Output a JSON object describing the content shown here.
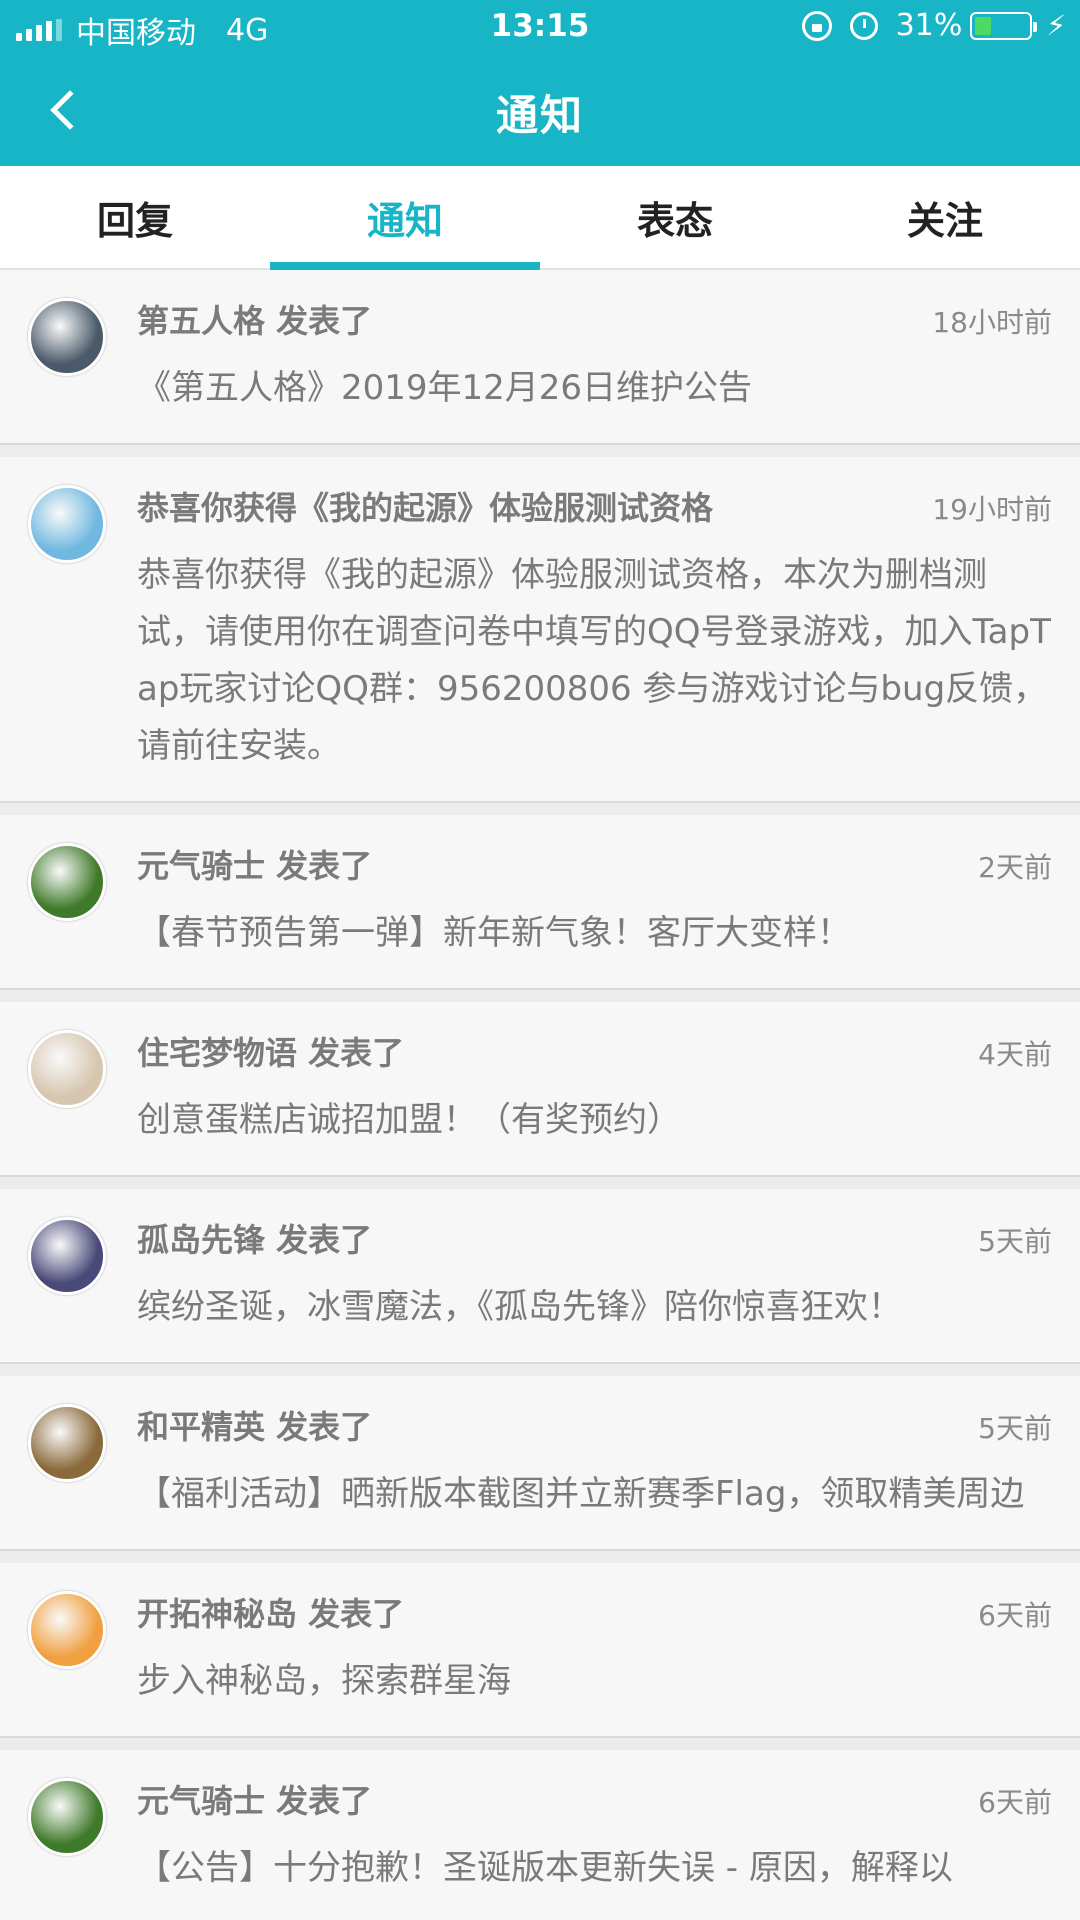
{
  "status_bar": {
    "carrier": "中国移动",
    "network": "4G",
    "time": "13:15",
    "battery_percent": "31%",
    "battery_level": 0.31
  },
  "header": {
    "title": "通知",
    "accent_color": "#17b5c5"
  },
  "tabs": [
    {
      "label": "回复",
      "active": false
    },
    {
      "label": "通知",
      "active": true
    },
    {
      "label": "表态",
      "active": false
    },
    {
      "label": "关注",
      "active": false
    }
  ],
  "notifications": [
    {
      "title": "第五人格 发表了",
      "time": "18小时前",
      "body": "《第五人格》2019年12月26日维护公告",
      "avatar_color": "#4a5a6a"
    },
    {
      "title": "恭喜你获得《我的起源》体验服测试资格",
      "time": "19小时前",
      "body": "恭喜你获得《我的起源》体验服测试资格，本次为删档测试，请使用你在调查问卷中填写的QQ号登录游戏，加入TapTap玩家讨论QQ群：956200806 参与游戏讨论与bug反馈，请前往安装。",
      "avatar_color": "#6fb8e0"
    },
    {
      "title": "元气骑士 发表了",
      "time": "2天前",
      "body": "【春节预告第一弹】新年新气象！客厅大变样！",
      "avatar_color": "#3f7a2a"
    },
    {
      "title": "住宅梦物语 发表了",
      "time": "4天前",
      "body": "创意蛋糕店诚招加盟！（有奖预约）",
      "avatar_color": "#d6c6b0"
    },
    {
      "title": "孤岛先锋 发表了",
      "time": "5天前",
      "body": "缤纷圣诞，冰雪魔法，《孤岛先锋》陪你惊喜狂欢！",
      "avatar_color": "#4a4a7a"
    },
    {
      "title": "和平精英 发表了",
      "time": "5天前",
      "body": "【福利活动】晒新版本截图并立新赛季Flag，领取精美周边",
      "avatar_color": "#8a6a3a"
    },
    {
      "title": "开拓神秘岛 发表了",
      "time": "6天前",
      "body": "步入神秘岛，探索群星海",
      "avatar_color": "#f0a040"
    },
    {
      "title": "元气骑士 发表了",
      "time": "6天前",
      "body": "【公告】十分抱歉！圣诞版本更新失误 - 原因，解释以",
      "avatar_color": "#3f7a2a"
    }
  ]
}
